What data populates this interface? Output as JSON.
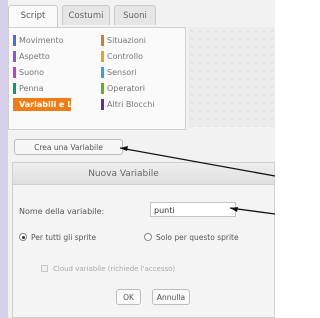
{
  "tabs": [
    {
      "label": "Script"
    },
    {
      "label": "Costumi"
    },
    {
      "label": "Suoni"
    }
  ],
  "palette": {
    "categories": [
      {
        "label": "Movimento",
        "color": "#4a6cd4"
      },
      {
        "label": "Situazioni",
        "color": "#c88330"
      },
      {
        "label": "Aspetto",
        "color": "#8a55d7"
      },
      {
        "label": "Controllo",
        "color": "#e1a91a"
      },
      {
        "label": "Suono",
        "color": "#bb42c3"
      },
      {
        "label": "Sensori",
        "color": "#2ca5e2"
      },
      {
        "label": "Penna",
        "color": "#0e9a6c"
      },
      {
        "label": "Operatori",
        "color": "#5cb712"
      },
      {
        "label": "Variabili e L",
        "color": "#ee7d16"
      },
      {
        "label": "Altri Blocchi",
        "color": "#632d99"
      }
    ],
    "selected_index": 8
  },
  "create_variable_button": "Crea una Variabile",
  "dialog": {
    "title": "Nuova Variabile",
    "name_label": "Nome della variabile:",
    "name_value": "punti",
    "radio_all_sprites": "Per tutti gli sprite",
    "radio_this_sprite": "Solo per questo sprite",
    "cloud_checkbox": "Cloud variabile (richiede l'accesso)",
    "ok": "OK",
    "cancel": "Annulla"
  }
}
